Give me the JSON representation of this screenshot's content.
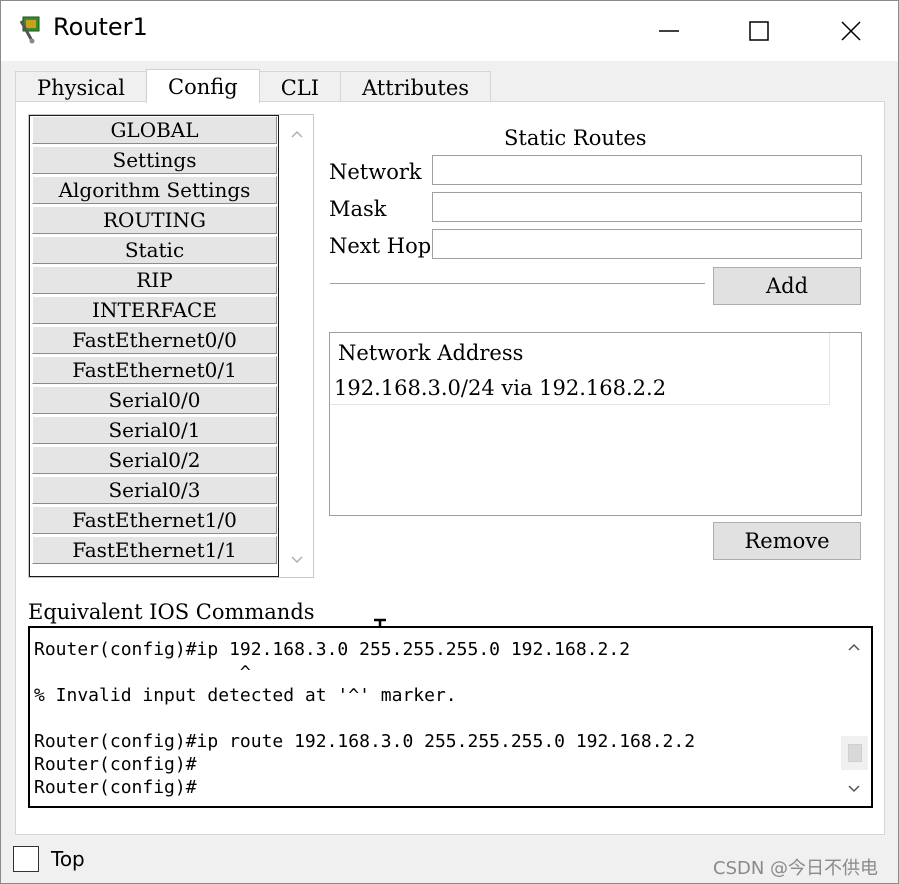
{
  "window": {
    "title": "Router1"
  },
  "tabs": [
    "Physical",
    "Config",
    "CLI",
    "Attributes"
  ],
  "active_tab": "Config",
  "nav": {
    "items": [
      "GLOBAL",
      "Settings",
      "Algorithm Settings",
      "ROUTING",
      "Static",
      "RIP",
      "INTERFACE",
      "FastEthernet0/0",
      "FastEthernet0/1",
      "Serial0/0",
      "Serial0/1",
      "Serial0/2",
      "Serial0/3",
      "FastEthernet1/0",
      "FastEthernet1/1"
    ]
  },
  "static_routes": {
    "title": "Static Routes",
    "network_label": "Network",
    "mask_label": "Mask",
    "next_hop_label": "Next Hop",
    "network_value": "",
    "mask_value": "",
    "next_hop_value": "",
    "add_label": "Add",
    "list_header": "Network Address",
    "routes": [
      "192.168.3.0/24 via 192.168.2.2"
    ],
    "remove_label": "Remove"
  },
  "ios": {
    "label": "Equivalent IOS Commands",
    "lines": [
      "Router(config)#ip 192.168.3.0 255.255.255.0 192.168.2.2",
      "                   ^",
      "% Invalid input detected at '^' marker.",
      "",
      "Router(config)#ip route 192.168.3.0 255.255.255.0 192.168.2.2",
      "Router(config)#",
      "Router(config)#"
    ]
  },
  "footer": {
    "top_label": "Top",
    "top_checked": false
  },
  "watermark": "CSDN @今日不供电",
  "colors": {
    "nav_item_bg": "#e5e5e5",
    "button_bg": "#e1e1e1",
    "client_bg": "#f0f0f0"
  }
}
